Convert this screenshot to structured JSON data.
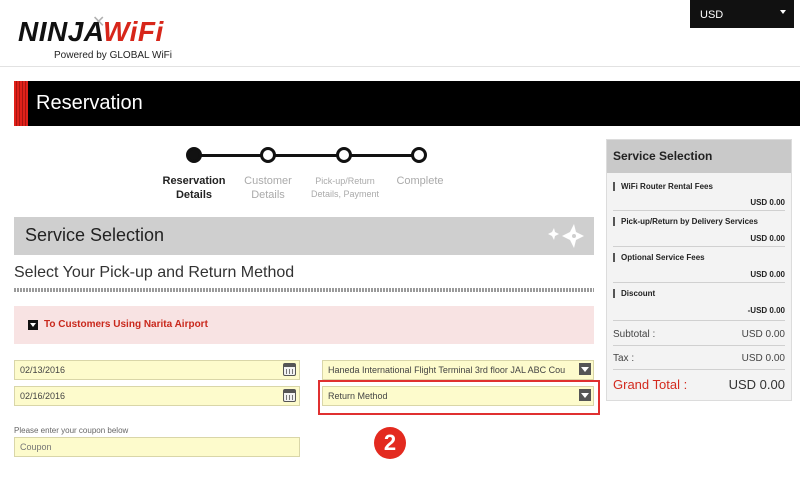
{
  "header": {
    "logo_main": "NINJA",
    "logo_accent": "WiFi",
    "logo_sub": "Powered by GLOBAL WiFi",
    "currency": "USD"
  },
  "page": {
    "title": "Reservation"
  },
  "steps": [
    {
      "label": "Reservation Details",
      "active": true
    },
    {
      "label": "Customer Details",
      "active": false
    },
    {
      "label": "Pick-up/Return Details, Payment",
      "active": false
    },
    {
      "label": "Complete",
      "active": false
    }
  ],
  "service_section": {
    "title": "Service Selection",
    "pickup_title": "Select Your Pick-up and Return Method",
    "narita_notice": "To Customers Using Narita Airport"
  },
  "form": {
    "pickup_date": "02/13/2016",
    "return_date": "02/16/2016",
    "pickup_location": "Haneda International Flight Terminal 3rd floor JAL ABC Cou",
    "return_method": "Return Method",
    "coupon_label": "Please enter your coupon below",
    "coupon_placeholder": "Coupon"
  },
  "annotation": {
    "step_number": "2",
    "highlight_color": "#e03030"
  },
  "summary": {
    "title": "Service Selection",
    "items": [
      {
        "label": "WiFi Router Rental Fees",
        "value": "USD 0.00"
      },
      {
        "label": "Pick-up/Return by Delivery Services",
        "value": "USD 0.00"
      },
      {
        "label": "Optional Service Fees",
        "value": "USD 0.00"
      },
      {
        "label": "Discount",
        "value": "-USD 0.00"
      }
    ],
    "subtotal_label": "Subtotal :",
    "subtotal_value": "USD 0.00",
    "tax_label": "Tax :",
    "tax_value": "USD 0.00",
    "grand_total_label": "Grand Total :",
    "grand_total_value": "USD 0.00"
  },
  "colors": {
    "brand_red": "#e0211a",
    "field_yellow": "#fdfbcc",
    "dark": "#000000"
  }
}
